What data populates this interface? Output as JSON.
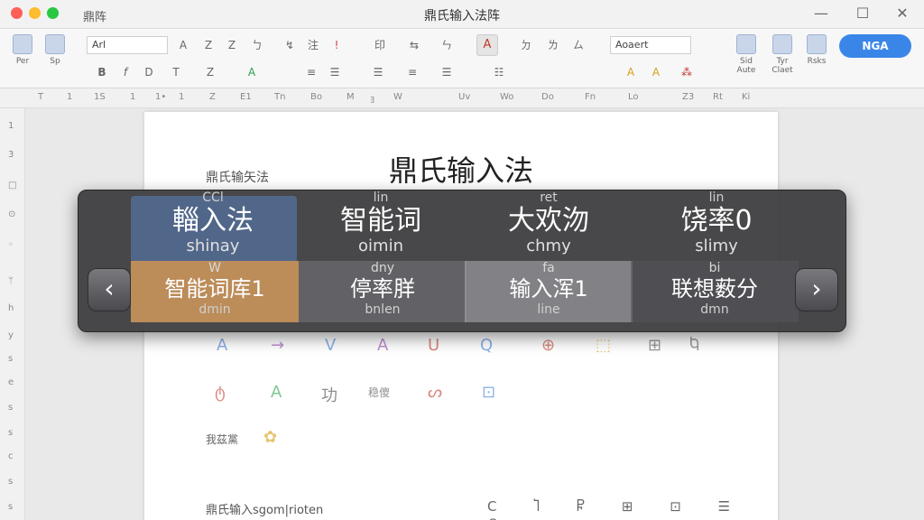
{
  "window": {
    "app_name": "鼎阵",
    "title": "鼎氏输入法阵",
    "controls": [
      "—",
      "☐",
      "✕"
    ]
  },
  "ribbon": {
    "left_labels": [
      "Per",
      "Sp"
    ],
    "font_name": "Arl",
    "size_name": "Aoaert",
    "right_labels": [
      "Sid Aute",
      "Tyr Claet",
      "Rsks"
    ],
    "nga_button": "NGA",
    "row1_glyphs": [
      "A",
      "Z",
      "Z",
      "ㄅ",
      "↯",
      "注",
      "!",
      "印",
      "⇆",
      "ㄣ",
      "ㄉ",
      "ㄌ",
      "ㄙ"
    ],
    "row2_glyphs": [
      "B",
      "f",
      "D",
      "T",
      "Z",
      "A",
      "≡",
      "☰",
      "☰",
      "≡",
      "☰",
      "☷",
      "A",
      "A",
      "⁂"
    ]
  },
  "ruler": {
    "marks": [
      "T",
      "1",
      "1S",
      "1",
      "1•",
      "1",
      "Z",
      "E1",
      "Tn",
      "Bo",
      "M",
      "ﾖ",
      "W",
      "Uv",
      "Wo",
      "Do",
      "Fn",
      "Lo",
      "Z3",
      "Rt",
      "Ki"
    ],
    "v_marks": [
      "1",
      "3",
      "□",
      "⊙",
      "◦",
      "ᛘ",
      "h",
      "y",
      "s",
      "e",
      "s",
      "s",
      "c",
      "s",
      "s"
    ]
  },
  "document": {
    "heading": "鼎氏输入法",
    "subheading": "鼎氏输矢法",
    "icon_row1": [
      "A",
      "→",
      "V",
      "A",
      "U",
      "Q",
      "⊕",
      "⬚",
      "⊞",
      "Ⴉ"
    ],
    "icon_row2": [
      "ტ",
      "A",
      "功",
      "稳傻",
      "ᔕ",
      "⊡"
    ],
    "label": "我茲黨",
    "bottom_text": "鼎氏输入sgom|rioten",
    "tools": [
      "C",
      "Ⴈ",
      "Ⴜ",
      "⊞",
      "⊡",
      "☰",
      "⊙"
    ]
  },
  "ime": {
    "top_candidates": [
      {
        "hint": "CCl",
        "main": "輜入法",
        "py": "shinay"
      },
      {
        "hint": "lin",
        "main": "智能词",
        "py": "oimin"
      },
      {
        "hint": "ret",
        "main": "大欢沕",
        "py": "chmy"
      },
      {
        "hint": "lin",
        "main": "饶率0",
        "py": "slimy"
      }
    ],
    "bottom_candidates": [
      {
        "hint": "W",
        "main": "智能词库1",
        "py": "dmin"
      },
      {
        "hint": "dny",
        "main": "停率羘",
        "py": "bnlen"
      },
      {
        "hint": "fa",
        "main": "输入浑1",
        "py": "line"
      },
      {
        "hint": "bi",
        "main": "联想薮分",
        "py": "dmn"
      }
    ],
    "prev_arrow": "‹",
    "next_arrow": "›"
  },
  "colors": {
    "accent": "#3a86e8",
    "selected_candidate": "#c9935b",
    "panel_bg": "#3a3a3c"
  }
}
